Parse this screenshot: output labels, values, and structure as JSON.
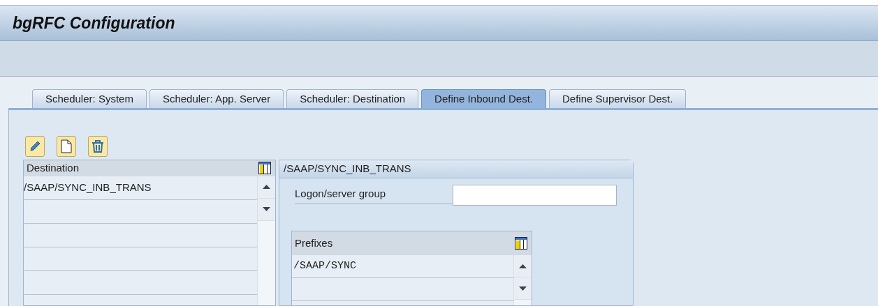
{
  "window": {
    "title": "bgRFC Configuration"
  },
  "tabs": [
    {
      "label": "Scheduler: System",
      "selected": false
    },
    {
      "label": "Scheduler: App. Server",
      "selected": false
    },
    {
      "label": "Scheduler: Destination",
      "selected": false
    },
    {
      "label": "Define Inbound Dest.",
      "selected": true
    },
    {
      "label": "Define Supervisor Dest.",
      "selected": false
    }
  ],
  "destination_table": {
    "columns": [
      "Destination"
    ],
    "rows": [
      "/SAAP/SYNC_INB_TRANS"
    ]
  },
  "detail_panel": {
    "title": "/SAAP/SYNC_INB_TRANS",
    "logon_server_group": {
      "label": "Logon/server group"
    },
    "prefixes_table": {
      "columns": [
        "Prefixes"
      ],
      "rows": [
        "/SAAP/SYNC"
      ]
    }
  }
}
